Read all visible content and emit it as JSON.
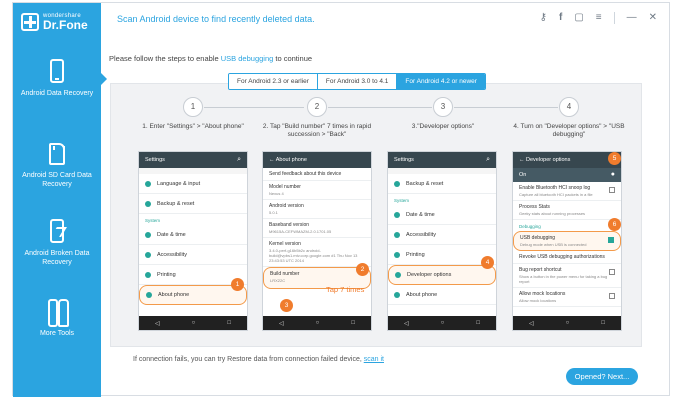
{
  "app": {
    "logo_sub": "wondershare",
    "logo_main": "Dr.Fone",
    "title": "Scan Android device to find recently deleted data."
  },
  "window_controls": [
    "key-icon",
    "facebook-icon",
    "feedback-icon",
    "menu-icon",
    "minimize-icon",
    "close-icon"
  ],
  "sidebar": {
    "items": [
      {
        "label": "Android Data Recovery",
        "icon": "phone-icon",
        "active": true
      },
      {
        "label": "Android SD Card Data Recovery",
        "icon": "sd-card-icon",
        "active": false
      },
      {
        "label": "Android Broken Data Recovery",
        "icon": "broken-phone-icon",
        "active": false
      },
      {
        "label": "More Tools",
        "icon": "tools-icon",
        "active": false
      }
    ]
  },
  "instruction": {
    "prefix": "Please follow the steps to enable ",
    "link": "USB debugging",
    "suffix": " to continue"
  },
  "tabs": [
    {
      "label": "For Android 2.3 or earlier",
      "active": false
    },
    {
      "label": "For Android 3.0 to 4.1",
      "active": false
    },
    {
      "label": "For Android 4.2 or newer",
      "active": true
    }
  ],
  "steps": [
    {
      "num": "1",
      "text": "1. Enter \"Settings\" > \"About phone\""
    },
    {
      "num": "2",
      "text": "2. Tap \"Build number\" 7 times in rapid succession > \"Back\""
    },
    {
      "num": "3",
      "text": "3.\"Developer options\""
    },
    {
      "num": "4",
      "text": "4. Turn on \"Developer options\" > \"USB debugging\""
    }
  ],
  "phone1": {
    "title": "Settings",
    "rows": [
      "Language & input",
      "Backup & reset"
    ],
    "section": "System",
    "rows2": [
      "Date & time",
      "Accessibility",
      "Printing",
      "About phone"
    ],
    "badge": "1"
  },
  "phone2": {
    "title": "About phone",
    "items": [
      {
        "title": "Send feedback about this device",
        "sub": ""
      },
      {
        "title": "Model number",
        "sub": "Nexus 4"
      },
      {
        "title": "Android version",
        "sub": "5.0.1"
      },
      {
        "title": "Baseband version",
        "sub": "M9615A-CEFWMAZM-2.0.1701.05"
      },
      {
        "title": "Kernel version",
        "sub": "3.4.0-perf-g16b5b2c android-build@vpbs1.mtv.corp.google.com #1 Thu Nov 13 23:43:53 UTC 2014"
      },
      {
        "title": "Build number",
        "sub": "LRX22C"
      }
    ],
    "tap_text": "Tap 7 times",
    "badge_build": "2",
    "badge_back": "3"
  },
  "phone3": {
    "title": "Settings",
    "rows": [
      "Backup & reset"
    ],
    "section": "System",
    "rows2": [
      "Date & time",
      "Accessibility",
      "Printing",
      "Developer options",
      "About phone"
    ],
    "badge": "4"
  },
  "phone4": {
    "title": "Developer options",
    "toggle_label": "On",
    "items": [
      {
        "title": "Enable Bluetooth HCI snoop log",
        "sub": "Capture all bluetooth HCI packets in a file",
        "check": false
      },
      {
        "title": "Process Stats",
        "sub": "Geeky stats about running processes",
        "check": null
      },
      {
        "title": "USB debugging",
        "sub": "Debug mode when USB is connected",
        "check": true
      },
      {
        "title": "Revoke USB debugging authorizations",
        "sub": "",
        "check": null
      },
      {
        "title": "Bug report shortcut",
        "sub": "Show a button in the power menu for taking a bug report",
        "check": false
      },
      {
        "title": "Allow mock locations",
        "sub": "Allow mock locations",
        "check": false
      }
    ],
    "section": "Debugging",
    "badge_toggle": "5",
    "badge_usb": "6"
  },
  "footer": {
    "text": "If connection fails, you can try Restore data from connection failed device, ",
    "link": "scan it"
  },
  "next_button": "Opened? Next..."
}
